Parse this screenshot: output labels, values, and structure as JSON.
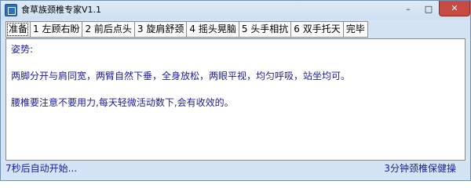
{
  "window": {
    "title": "食草族颈椎专家V1.1",
    "minimize_glyph": "–",
    "maximize_glyph": "□",
    "close_glyph": "✕"
  },
  "tabs": [
    {
      "label": "准备",
      "active": true
    },
    {
      "label": "1 左顾右盼",
      "active": false
    },
    {
      "label": "2 前后点头",
      "active": false
    },
    {
      "label": "3 旋肩舒颈",
      "active": false
    },
    {
      "label": "4 摇头晃脑",
      "active": false
    },
    {
      "label": "5 头手相抗",
      "active": false
    },
    {
      "label": "6 双手托天",
      "active": false
    },
    {
      "label": "完毕",
      "active": false
    }
  ],
  "content": {
    "heading": "姿势:",
    "paragraph1": "两脚分开与肩同宽，两臂自然下垂，全身放松，两眼平视，均匀呼吸，站坐均可。",
    "paragraph2": "腰椎要注意不要用力,每天轻微活动数下,会有收效的。"
  },
  "status": {
    "left": "7秒后自动开始...",
    "right": "3分钟颈椎保健操"
  },
  "colors": {
    "text_blue": "#1a1aa0",
    "close_red": "#c74b42",
    "frame": "#d4e4f4"
  }
}
